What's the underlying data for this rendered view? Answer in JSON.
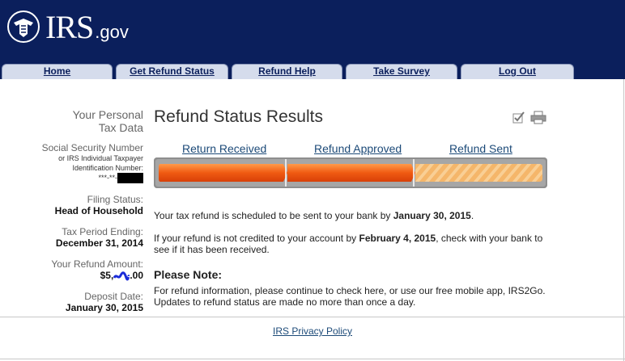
{
  "header": {
    "logo_irs": "IRS",
    "logo_gov": ".gov"
  },
  "nav": {
    "tabs": [
      "Home",
      "Get Refund Status",
      "Refund Help",
      "Take Survey",
      "Log Out"
    ]
  },
  "sidebar": {
    "heading_line1": "Your Personal",
    "heading_line2": "Tax Data",
    "ssn_label": "Social Security Number",
    "ssn_sub1": "or IRS Individual Taxpayer",
    "ssn_sub2": "Identification Number:",
    "ssn_value": "***-**-",
    "filing_label": "Filing Status:",
    "filing_value": "Head of Household",
    "period_label": "Tax Period Ending:",
    "period_value": "December 31, 2014",
    "refund_label": "Your Refund Amount:",
    "refund_prefix": "$5,",
    "refund_suffix": ".00",
    "deposit_label": "Deposit Date:",
    "deposit_value": "January 30, 2015"
  },
  "main": {
    "title": "Refund Status Results",
    "steps": [
      "Return Received",
      "Refund Approved",
      "Refund Sent"
    ],
    "progress_completed_steps": 2,
    "progress_total_steps": 3,
    "msg1_pre": "Your tax refund is scheduled to be sent to your bank by ",
    "msg1_bold": "January 30, 2015",
    "msg1_post": ".",
    "msg2_pre": "If your refund is not credited to your account by ",
    "msg2_bold": "February 4, 2015",
    "msg2_post": ", check with your bank to see if it has been received.",
    "note_heading": "Please Note:",
    "note_text": "For refund information, please continue to check here, or use our free mobile app, IRS2Go. Updates to refund status are made no more than once a day."
  },
  "footer": {
    "privacy_link": "IRS Privacy Policy"
  },
  "colors": {
    "header_bg": "#0b1f5c",
    "progress_done": "#f05a12",
    "progress_pending": "#f5b66a"
  }
}
